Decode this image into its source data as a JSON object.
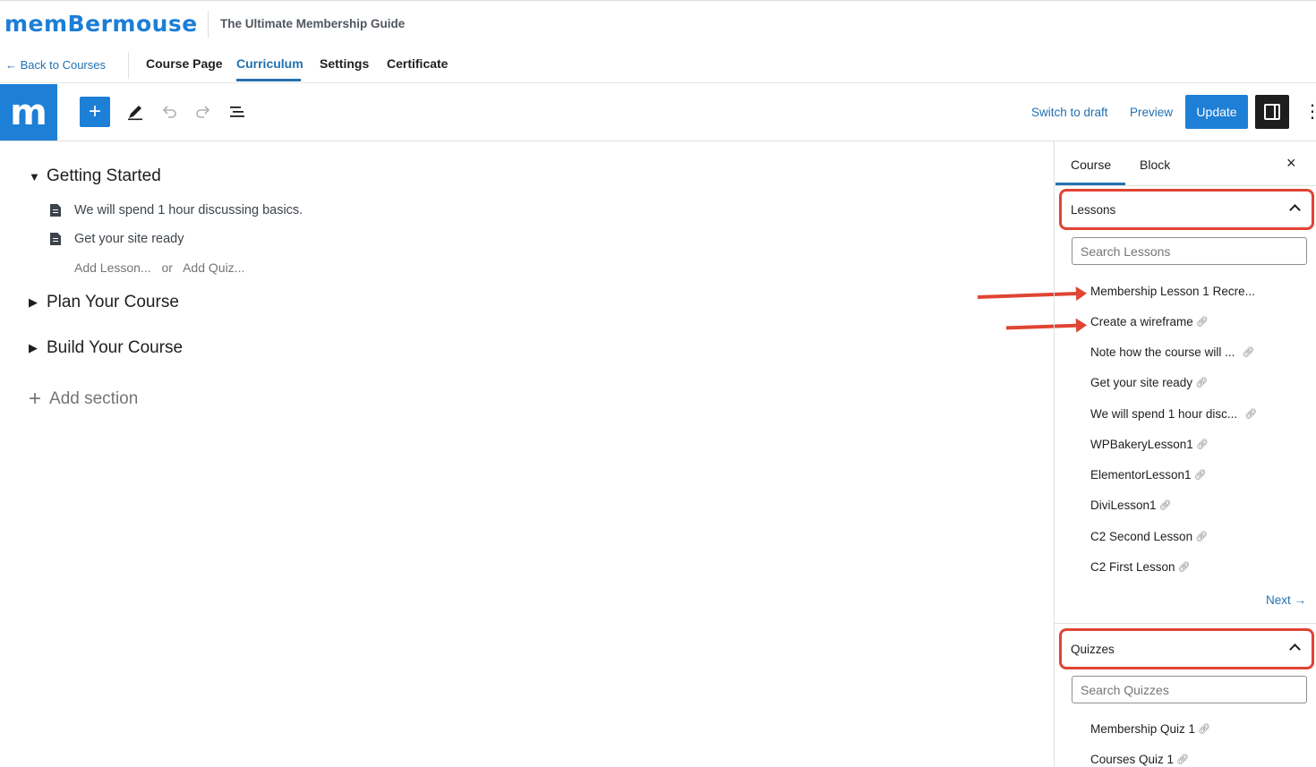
{
  "header": {
    "logo_text": "memBermouse",
    "course_title": "The Ultimate Membership Guide",
    "back_link": "← Back to Courses",
    "nav_tabs": [
      "Course Page",
      "Curriculum",
      "Settings",
      "Certificate"
    ],
    "active_tab": "Curriculum"
  },
  "toolbar": {
    "logo_letter": "m",
    "add_label": "+",
    "switch_to_draft": "Switch to draft",
    "preview": "Preview",
    "update": "Update"
  },
  "curriculum": {
    "sections": [
      {
        "title": "Getting Started",
        "expanded": true,
        "lessons": [
          "We will spend 1 hour discussing basics.",
          "Get your site ready"
        ]
      },
      {
        "title": "Plan Your Course",
        "expanded": false
      },
      {
        "title": "Build Your Course",
        "expanded": false
      }
    ],
    "add_lesson": "Add Lesson...",
    "or": "or",
    "add_quiz": "Add Quiz...",
    "add_section": "Add section"
  },
  "sidebar": {
    "tabs": [
      "Course",
      "Block"
    ],
    "active_tab": "Course",
    "close": "×",
    "lessons_panel": {
      "title": "Lessons",
      "search_placeholder": "Search Lessons",
      "items": [
        "Membership Lesson 1 Recre...",
        "Create a wireframe",
        "Note how the course will ...",
        "Get your site ready",
        "We will spend 1 hour disc...",
        "WPBakeryLesson1",
        "ElementorLesson1",
        "DiviLesson1",
        "C2 Second Lesson",
        "C2 First Lesson"
      ],
      "next": "Next →"
    },
    "quizzes_panel": {
      "title": "Quizzes",
      "search_placeholder": "Search Quizzes",
      "items": [
        "Membership Quiz 1",
        "Courses Quiz 1"
      ]
    }
  },
  "colors": {
    "accent": "#1e7fd6",
    "link": "#2271b1",
    "annotation": "#e04434"
  }
}
